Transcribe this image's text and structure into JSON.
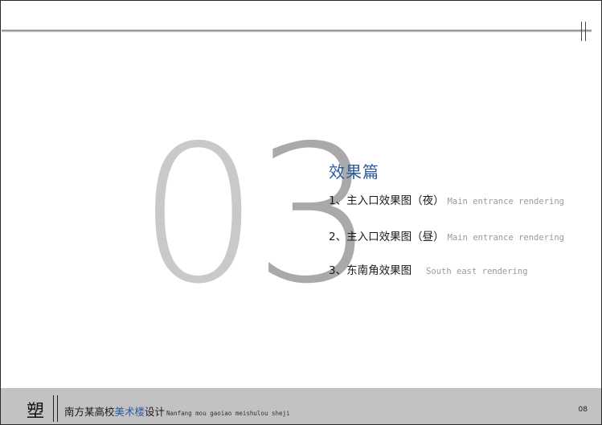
{
  "section": {
    "number_d1": "0",
    "number_d2": "3",
    "title": "效果篇",
    "items": [
      {
        "cn": "1、主入口效果图（夜）",
        "en": "Main entrance rendering"
      },
      {
        "cn": "2、主入口效果图（昼）",
        "en": "Main entrance rendering"
      },
      {
        "cn": "3、东南角效果图",
        "en": "South east rendering"
      }
    ]
  },
  "footer": {
    "glyph": "塑",
    "title_prefix": "南方某高校",
    "title_highlight": "美术楼",
    "title_suffix": "设计",
    "pinyin": "Nanfang mou gaoiao meishulou sheji",
    "page": "08"
  },
  "colors": {
    "accent": "#2d5aa0",
    "footer_bg": "#c2c2c2",
    "digit_light": "#c9c9c9",
    "digit_dark": "#a9a9a9"
  }
}
